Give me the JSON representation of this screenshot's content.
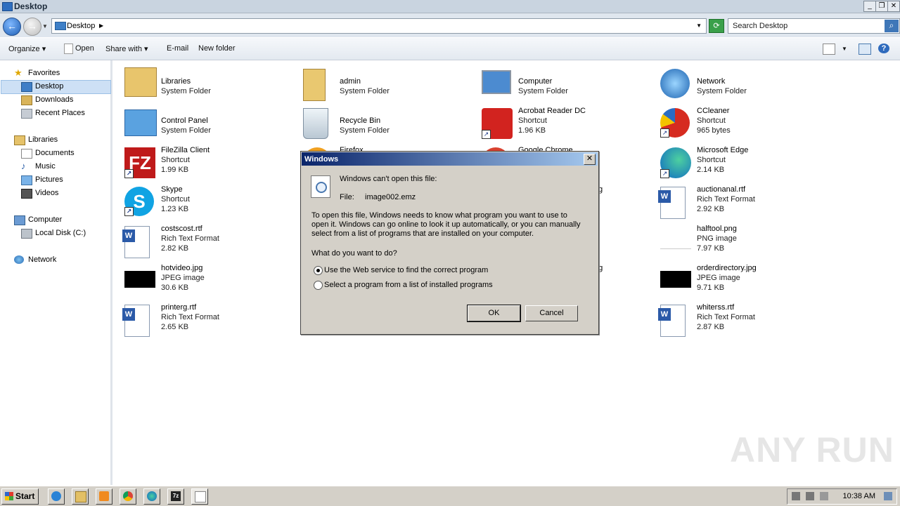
{
  "window": {
    "title": "Desktop"
  },
  "address": {
    "crumb": "Desktop",
    "search_placeholder": "Search Desktop"
  },
  "toolbar": {
    "organize": "Organize",
    "open": "Open",
    "share_with": "Share with",
    "email": "E-mail",
    "new_folder": "New folder"
  },
  "nav": {
    "favorites": "Favorites",
    "desktop": "Desktop",
    "downloads": "Downloads",
    "recent_places": "Recent Places",
    "libraries": "Libraries",
    "documents": "Documents",
    "music": "Music",
    "pictures": "Pictures",
    "videos": "Videos",
    "computer": "Computer",
    "local_disk": "Local Disk (C:)",
    "network": "Network"
  },
  "files": {
    "libraries": {
      "name": "Libraries",
      "type": "System Folder"
    },
    "admin": {
      "name": "admin",
      "type": "System Folder"
    },
    "computer": {
      "name": "Computer",
      "type": "System Folder"
    },
    "network": {
      "name": "Network",
      "type": "System Folder"
    },
    "control_panel": {
      "name": "Control Panel",
      "type": "System Folder"
    },
    "recycle_bin": {
      "name": "Recycle Bin",
      "type": "System Folder"
    },
    "acrobat": {
      "name": "Acrobat Reader DC",
      "type": "Shortcut",
      "size": "1.96 KB"
    },
    "ccleaner": {
      "name": "CCleaner",
      "type": "Shortcut",
      "size": "965 bytes"
    },
    "filezilla": {
      "name": "FileZilla Client",
      "type": "Shortcut",
      "size": "1.99 KB"
    },
    "firefox": {
      "name": "Firefox"
    },
    "chrome": {
      "name": "Google Chrome"
    },
    "edge": {
      "name": "Microsoft Edge",
      "type": "Shortcut",
      "size": "2.14 KB"
    },
    "skype": {
      "name": "Skype",
      "type": "Shortcut",
      "size": "1.23 KB"
    },
    "auctionanal": {
      "name": "auctionanal.rtf",
      "type": "Rich Text Format",
      "size": "2.92 KB"
    },
    "costscost": {
      "name": "costscost.rtf",
      "type": "Rich Text Format",
      "size": "2.82 KB"
    },
    "halftool": {
      "name": "halftool.png",
      "type": "PNG image",
      "size": "7.97 KB"
    },
    "hotvideo": {
      "name": "hotvideo.jpg",
      "type": "JPEG image",
      "size": "30.6 KB"
    },
    "orderdirectory": {
      "name": "orderdirectory.jpg",
      "type": "JPEG image",
      "size": "9.71 KB"
    },
    "printerg": {
      "name": "printerg.rtf",
      "type": "Rich Text Format",
      "size": "2.65 KB"
    },
    "whiterss": {
      "name": "whiterss.rtf",
      "type": "Rich Text Format",
      "size": "2.87 KB"
    },
    "partial_g1": "g",
    "partial_g2": "ng"
  },
  "dialog": {
    "title": "Windows",
    "heading": "Windows can't open this file:",
    "file_label": "File:",
    "file_name": "image002.emz",
    "line1": "To open this file, Windows needs to know what program you want to use to",
    "line2": "open it. Windows can go online to look it up automatically, or you can manually",
    "line3": "select from a list of programs that are installed on your computer.",
    "question": "What do you want to do?",
    "opt_web": "Use the Web service to find the correct program",
    "opt_list": "Select a program from a list of installed programs",
    "ok": "OK",
    "cancel": "Cancel"
  },
  "taskbar": {
    "start": "Start",
    "clock": "10:38 AM"
  },
  "watermark": "ANY RUN"
}
